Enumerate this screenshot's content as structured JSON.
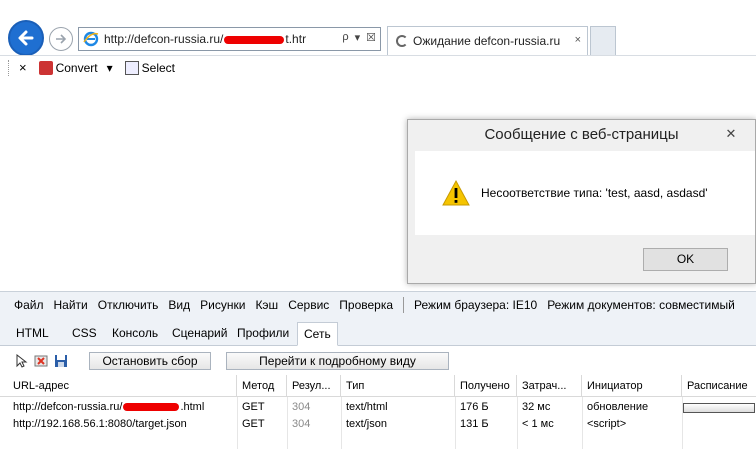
{
  "browser": {
    "url_prefix": "http://defcon-russia.ru/",
    "url_suffix": "t.htr",
    "addr_search_glyph": "ρ",
    "addr_dropdown_glyph": "▾",
    "addr_refresh_glyph": "☒",
    "tab_title": "Ожидание defcon-russia.ru",
    "tab_close": "×",
    "cmd_close": "×",
    "convert_label": "Convert",
    "convert_dropdown": "▾",
    "select_label": "Select"
  },
  "dialog": {
    "title": "Сообщение с веб-страницы",
    "close": "✕",
    "message": "Несоответствие типа: 'test, aasd, asdasd'",
    "ok_label": "OK"
  },
  "devtools": {
    "menu": [
      "Файл",
      "Найти",
      "Отключить",
      "Вид",
      "Рисунки",
      "Кэш",
      "Сервис",
      "Проверка"
    ],
    "browser_mode": "Режим браузера: IE10",
    "doc_mode": "Режим документов: совместимый",
    "tabs": [
      "HTML",
      "CSS",
      "Консоль",
      "Сценарий",
      "Профили",
      "Сеть"
    ],
    "active_tab": "Сеть",
    "stop_button": "Остановить сбор",
    "detail_button": "Перейти к подробному виду",
    "columns": [
      "URL-адрес",
      "Метод",
      "Резул...",
      "Тип",
      "Получено",
      "Затрач...",
      "Инициатор",
      "Расписание"
    ],
    "rows": [
      {
        "url_prefix": "http://defcon-russia.ru/",
        "url_suffix": ".html",
        "method": "GET",
        "result": "304",
        "type": "text/html",
        "received": "176 Б",
        "time": "32 мс",
        "initiator": "обновление"
      },
      {
        "url": "http://192.168.56.1:8080/target.json",
        "method": "GET",
        "result": "304",
        "type": "text/json",
        "received": "131 Б",
        "time": "< 1 мс",
        "initiator": "<script>"
      }
    ]
  }
}
